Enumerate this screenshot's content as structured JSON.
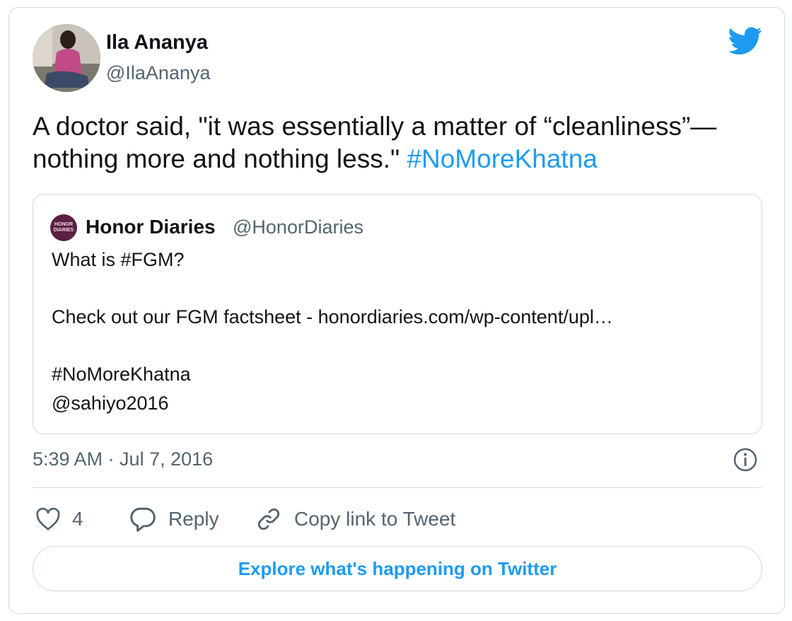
{
  "author": {
    "name": "Ila Ananya",
    "handle": "@IlaAnanya"
  },
  "tweet": {
    "text": "A doctor said, \"it was essentially a matter of “cleanliness”— nothing more and nothing less.\"",
    "hashtag": "#NoMoreKhatna"
  },
  "quoted": {
    "avatar_text_line1": "HONOR",
    "avatar_text_line2": "DIARIES",
    "name": "Honor Diaries",
    "handle": "@HonorDiaries",
    "lines": [
      "What is #FGM?",
      "",
      "Check out our FGM factsheet - honordiaries.com/wp-content/upl…",
      "",
      "#NoMoreKhatna",
      "@sahiyo2016"
    ]
  },
  "timestamp": "5:39 AM · Jul 7, 2016",
  "actions": {
    "like_count": "4",
    "reply_label": "Reply",
    "copy_link_label": "Copy link to Tweet"
  },
  "cta_label": "Explore what's happening on Twitter",
  "colors": {
    "accent": "#1d9bf0",
    "secondary_text": "#536471",
    "border": "#cfd9de"
  },
  "icons": [
    "twitter-bird-icon",
    "info-icon",
    "heart-icon",
    "reply-icon",
    "link-icon"
  ]
}
